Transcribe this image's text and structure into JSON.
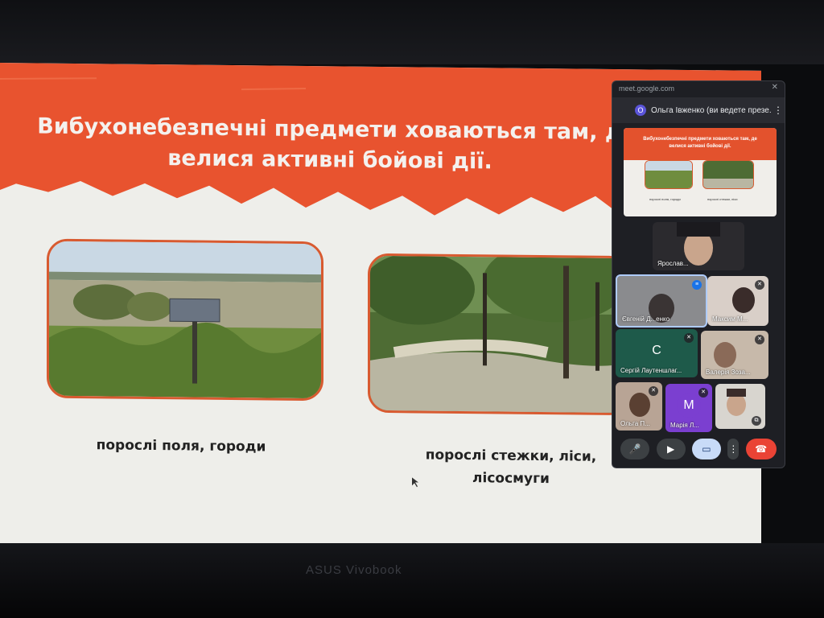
{
  "device_brand": "ASUS Vivobook",
  "slide": {
    "title_line1": "Вибухонебезпечні предмети ховаються там, д",
    "title_line2": "велися активні бойові дії.",
    "caption1": "порослі поля, городи",
    "caption2_line1": "порослі стежки, ліси,",
    "caption2_line2": "лісосмуги",
    "banner_color": "#e8532f",
    "accent_color": "#d85a30"
  },
  "meet": {
    "url": "meet.google.com",
    "presenter_initial": "O",
    "presenter_label": "Ольга Івженко (ви ведете презе...",
    "preview": {
      "title_line1": "Вибухонебезпечні предмети ховаються там, де",
      "title_line2": "велися активні бойові дії.",
      "caption1": "порослі поля, городи",
      "caption2": "порослі стежки, ліси"
    },
    "participants": [
      {
        "name": "Ярослав..."
      },
      {
        "name": "Євгеній Д...енко"
      },
      {
        "name": "Максим М..."
      },
      {
        "name": "Сергій Лаутеншлаг...",
        "initial": "С",
        "color": "#1e5a4a"
      },
      {
        "name": "Валерія Зоза..."
      },
      {
        "name": "Ольга П..."
      },
      {
        "name": "Марія Л...",
        "initial": "М",
        "color": "#7b3fd0"
      },
      {
        "name": ""
      }
    ],
    "controls": {
      "mic_icon": "mic-icon",
      "camera_icon": "camera-icon",
      "present_icon": "present-screen-icon",
      "more_icon": "more-vert-icon",
      "leave_icon": "phone-hangup-icon",
      "leave_color": "#ea4335"
    }
  }
}
